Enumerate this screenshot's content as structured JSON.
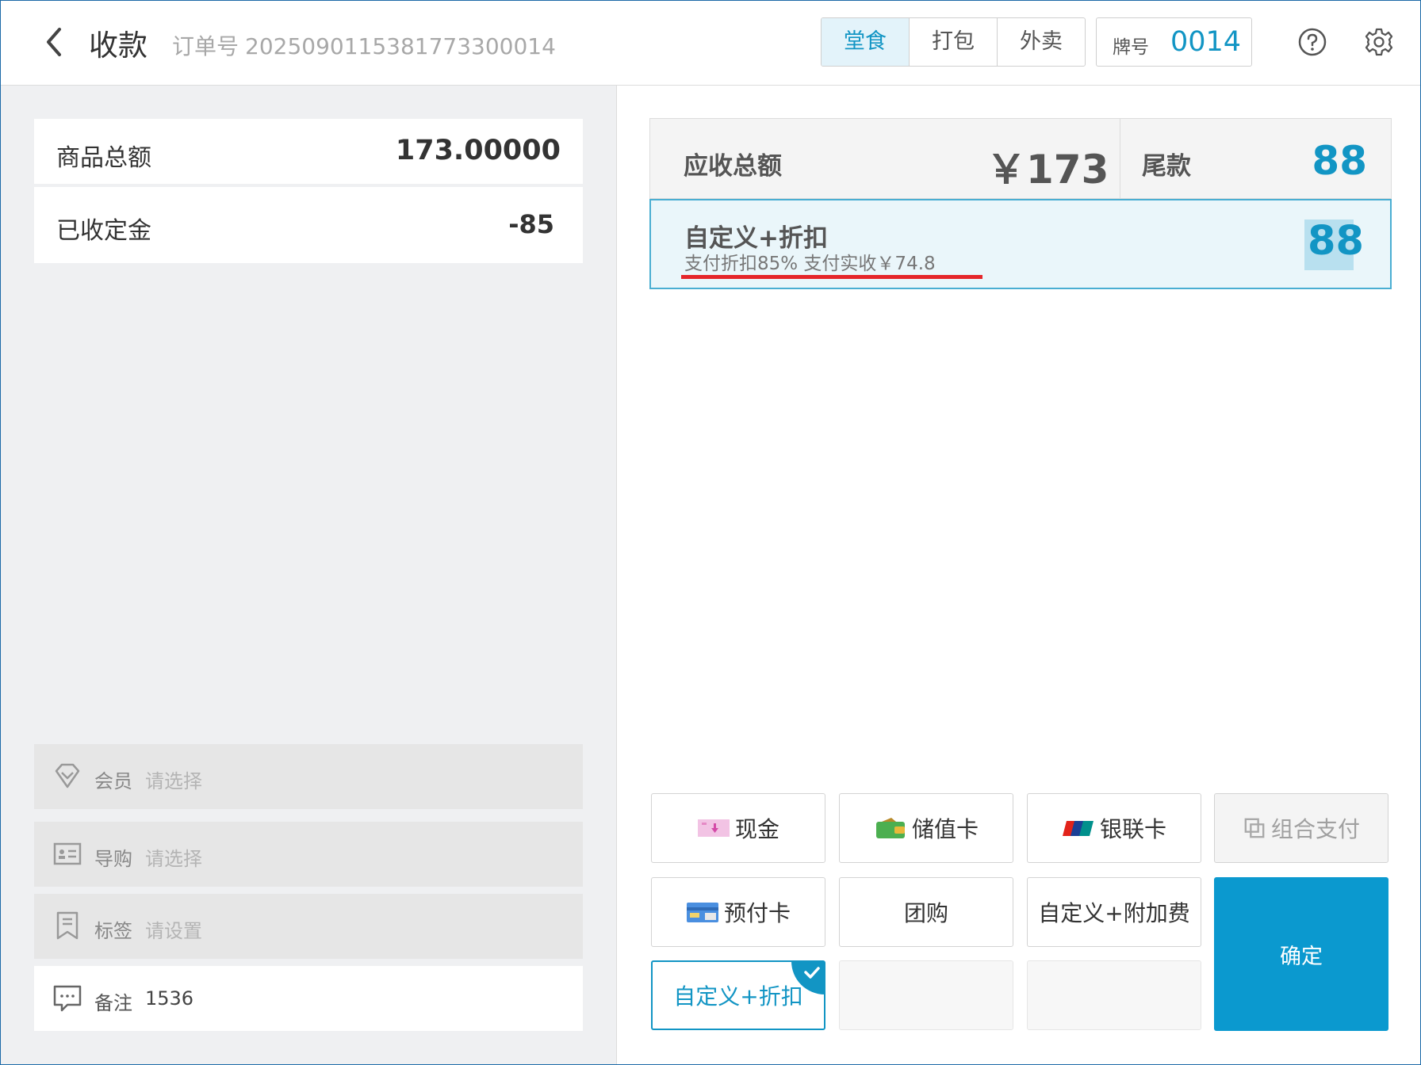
{
  "header": {
    "title": "收款",
    "order_label": "订单号",
    "order_number": "2025090115381773300014",
    "dining_modes": [
      "堂食",
      "打包",
      "外卖"
    ],
    "active_mode": "堂食",
    "pai_label": "牌号",
    "pai_number": "0014",
    "icons": [
      "back-icon",
      "help-icon",
      "settings-icon"
    ]
  },
  "summary": {
    "goods_total_label": "商品总额",
    "goods_total_value": "173.00000",
    "deposit_label": "已收定金",
    "deposit_value": "-85"
  },
  "options": [
    {
      "label": "会员",
      "value": "请选择",
      "icon": "diamond-icon"
    },
    {
      "label": "导购",
      "value": "请选择",
      "icon": "id-card-icon"
    },
    {
      "label": "标签",
      "value": "请设置",
      "icon": "bookmark-icon"
    },
    {
      "label": "备注",
      "value": "1536",
      "icon": "comment-icon"
    }
  ],
  "totals": {
    "receivable_label": "应收总额",
    "receivable_value": "￥173",
    "balance_label": "尾款",
    "balance_value": "88"
  },
  "selected_payment": {
    "title": "自定义+折扣",
    "detail": "支付折扣85% 支付实收￥74.8",
    "amount": "88"
  },
  "payment_buttons": [
    {
      "label": "现金",
      "icon": "cash-icon"
    },
    {
      "label": "储值卡",
      "icon": "wallet-icon"
    },
    {
      "label": "银联卡",
      "icon": "unionpay-icon"
    },
    {
      "label": "组合支付",
      "icon": "combine-icon"
    },
    {
      "label": "预付卡",
      "icon": "prepaid-card-icon"
    },
    {
      "label": "团购"
    },
    {
      "label": "自定义+附加费"
    },
    {
      "label": "自定义+折扣"
    }
  ],
  "confirm_label": "确定",
  "colors": {
    "accent": "#1295c4",
    "confirm": "#0b99cf",
    "underline": "#e5262a"
  }
}
